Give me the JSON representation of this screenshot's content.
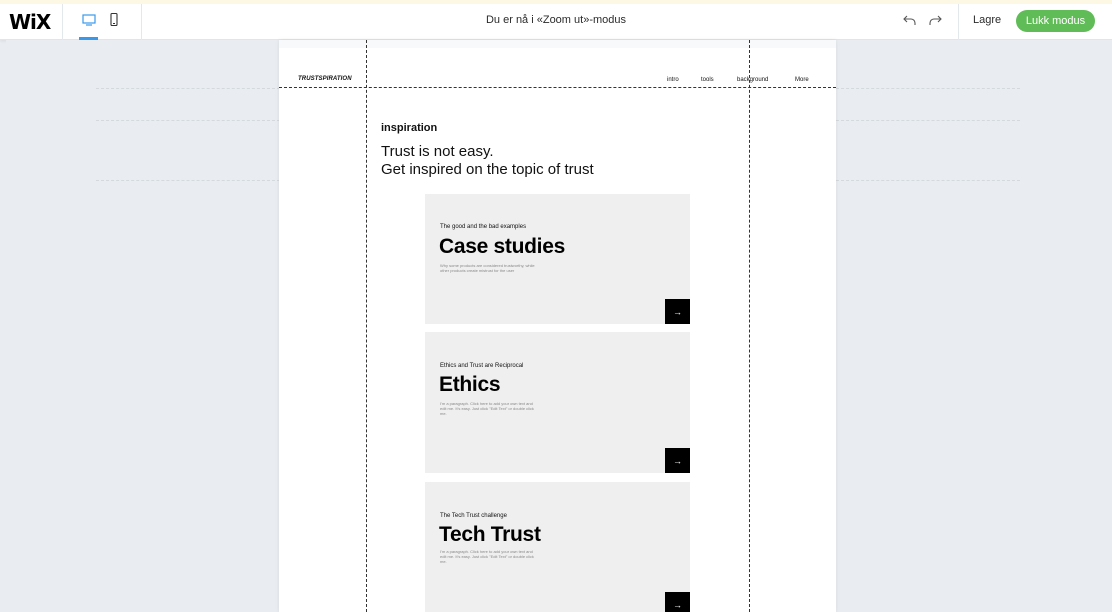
{
  "topbar": {
    "logo": "WiX",
    "mode_title": "Du er nå i «Zoom ut»-modus",
    "save_label": "Lagre",
    "close_mode_label": "Lukk modus",
    "accent_color": "#3899ec",
    "close_button_color": "#60bc57"
  },
  "site": {
    "brand": "TRUSTSPIRATION",
    "nav": [
      "intro",
      "tools",
      "background",
      "More"
    ],
    "eyebrow": "inspiration",
    "intro_line1": "Trust is not easy.",
    "intro_line2": "Get inspired on the topic of trust",
    "cards": [
      {
        "kicker": "The good and the bad examples",
        "title": "Case studies",
        "desc": "Why some products are considered trustworthy, while other products create mistrust for the user",
        "arrow": "→"
      },
      {
        "kicker": "Ethics and Trust are Reciprocal",
        "title": "Ethics",
        "desc": "I'm a paragraph. Click here to add your own text and edit me. It's easy. Just click \"Edit Text\" or double click me.",
        "arrow": "→"
      },
      {
        "kicker": "The Tech Trust challenge",
        "title": "Tech Trust",
        "desc": "I'm a paragraph. Click here to add your own text and edit me. It's easy. Just click \"Edit Text\" or double click me.",
        "arrow": "→"
      }
    ]
  },
  "icons": {
    "desktop": "desktop-icon",
    "mobile": "mobile-icon",
    "undo": "undo-icon",
    "redo": "redo-icon",
    "arrow": "arrow-right-icon"
  }
}
